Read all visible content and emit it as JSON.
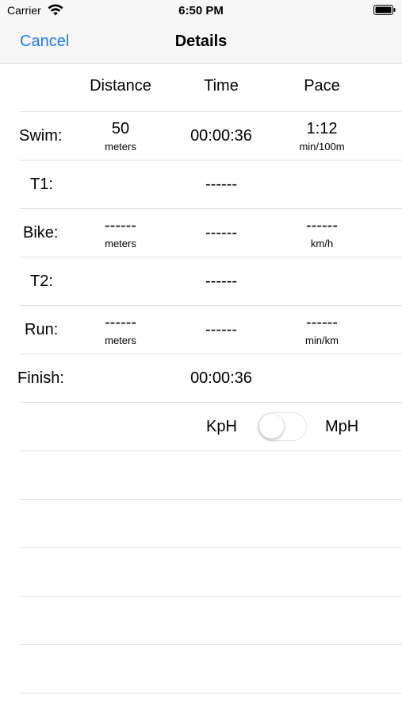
{
  "status_bar": {
    "carrier": "Carrier",
    "time": "6:50 PM"
  },
  "nav": {
    "cancel": "Cancel",
    "title": "Details"
  },
  "columns": {
    "distance": "Distance",
    "time": "Time",
    "pace": "Pace"
  },
  "rows": {
    "swim": {
      "label": "Swim:",
      "distance": "50",
      "distance_unit": "meters",
      "time": "00:00:36",
      "pace": "1:12",
      "pace_unit": "min/100m"
    },
    "t1": {
      "label": "T1:",
      "time": "------"
    },
    "bike": {
      "label": "Bike:",
      "distance": "------",
      "distance_unit": "meters",
      "time": "------",
      "pace": "------",
      "pace_unit": "km/h"
    },
    "t2": {
      "label": "T2:",
      "time": "------"
    },
    "run": {
      "label": "Run:",
      "distance": "------",
      "distance_unit": "meters",
      "time": "------",
      "pace": "------",
      "pace_unit": "min/km"
    },
    "finish": {
      "label": "Finish:",
      "time": "00:00:36"
    }
  },
  "units_toggle": {
    "left_label": "KpH",
    "right_label": "MpH",
    "is_on": false
  },
  "colors": {
    "accent": "#1a7cf5",
    "separator": "#e2e2e2",
    "bar_background": "#f7f7f7"
  }
}
